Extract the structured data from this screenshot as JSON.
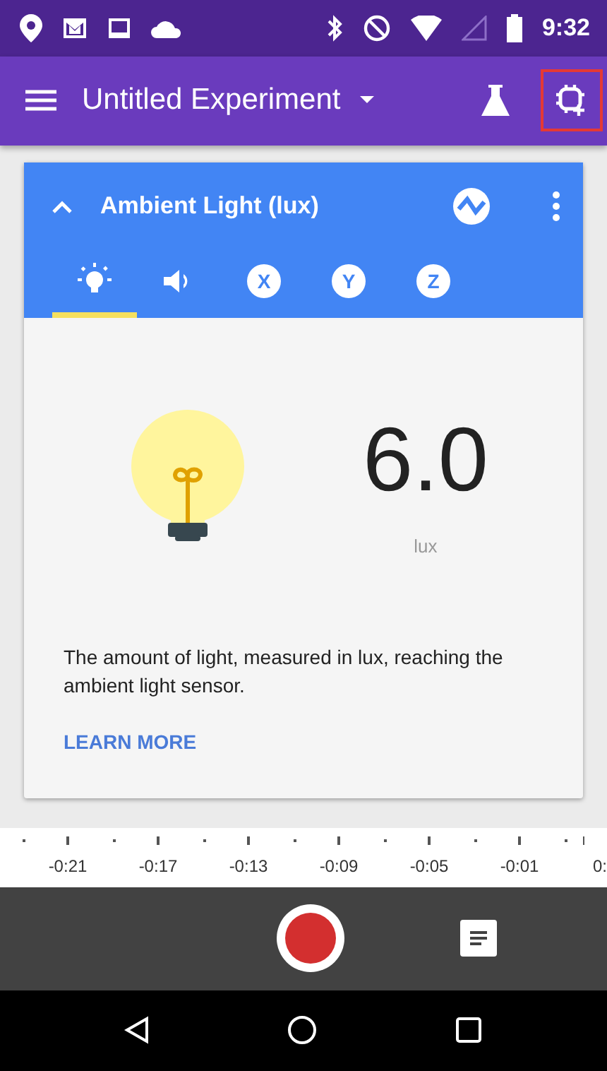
{
  "status_bar": {
    "time": "9:32"
  },
  "app_bar": {
    "title": "Untitled Experiment",
    "add_sensor_highlighted": true
  },
  "sensor_card": {
    "title": "Ambient Light (lux)",
    "expanded": true,
    "tabs": [
      {
        "kind": "light",
        "selected": true
      },
      {
        "kind": "sound",
        "selected": false
      },
      {
        "kind": "axis",
        "glyph": "X",
        "selected": false
      },
      {
        "kind": "axis",
        "glyph": "Y",
        "selected": false
      },
      {
        "kind": "axis",
        "glyph": "Z",
        "selected": false
      }
    ],
    "reading": "6.0",
    "unit": "lux",
    "description": "The amount of light, measured in lux, reaching the ambient light sensor.",
    "link": "LEARN MORE"
  },
  "timeline": {
    "labels": [
      "-0:21",
      "-0:17",
      "-0:13",
      "-0:09",
      "-0:05",
      "-0:01",
      "0:"
    ]
  }
}
